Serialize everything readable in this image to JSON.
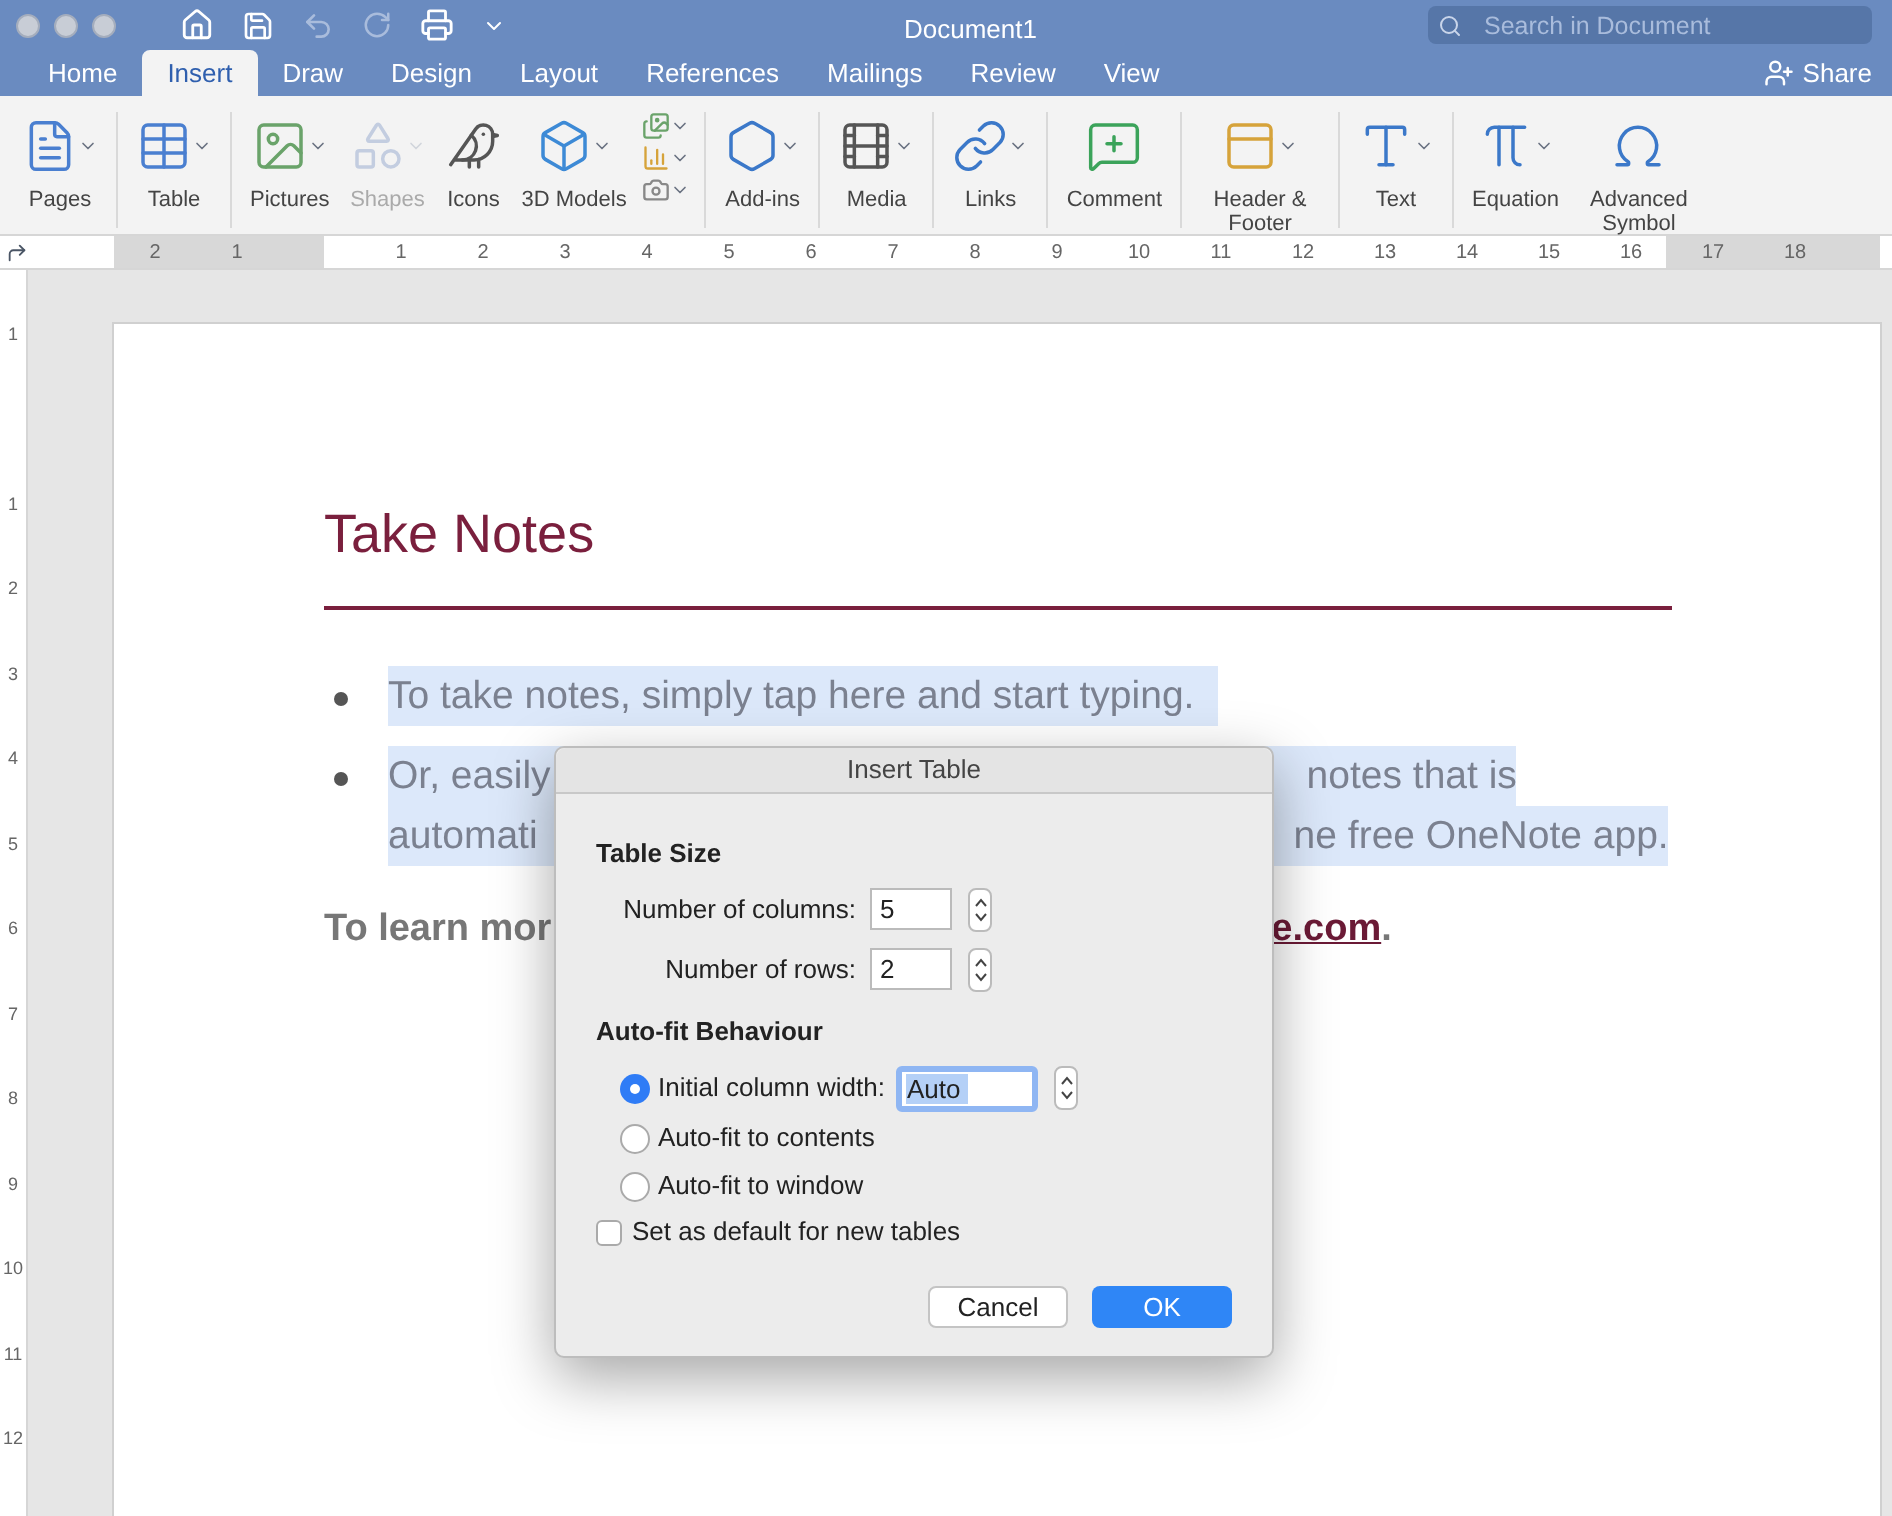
{
  "window": {
    "title": "Document1"
  },
  "search": {
    "placeholder": "Search in Document"
  },
  "tabs": [
    {
      "label": "Home",
      "selected": false
    },
    {
      "label": "Insert",
      "selected": true
    },
    {
      "label": "Draw",
      "selected": false
    },
    {
      "label": "Design",
      "selected": false
    },
    {
      "label": "Layout",
      "selected": false
    },
    {
      "label": "References",
      "selected": false
    },
    {
      "label": "Mailings",
      "selected": false
    },
    {
      "label": "Review",
      "selected": false
    },
    {
      "label": "View",
      "selected": false
    }
  ],
  "share": "Share",
  "ribbon": [
    {
      "label": "Pages",
      "dropdown": true,
      "disabled": false
    },
    {
      "label": "Table",
      "dropdown": true,
      "disabled": false
    },
    {
      "label": "Pictures",
      "dropdown": true,
      "disabled": false
    },
    {
      "label": "Shapes",
      "dropdown": true,
      "disabled": true
    },
    {
      "label": "Icons",
      "dropdown": false,
      "disabled": false
    },
    {
      "label": "3D Models",
      "dropdown": true,
      "disabled": false
    },
    {
      "label": "Add-ins",
      "dropdown": true,
      "disabled": false
    },
    {
      "label": "Media",
      "dropdown": true,
      "disabled": false
    },
    {
      "label": "Links",
      "dropdown": true,
      "disabled": false
    },
    {
      "label": "Comment",
      "dropdown": false,
      "disabled": false
    },
    {
      "label": "Header & Footer",
      "dropdown": true,
      "disabled": false
    },
    {
      "label": "Text",
      "dropdown": true,
      "disabled": false
    },
    {
      "label": "Equation",
      "dropdown": true,
      "disabled": false
    },
    {
      "label": "Advanced Symbol",
      "dropdown": false,
      "disabled": false
    }
  ],
  "ruler": {
    "left_numbers": [
      "2",
      "1"
    ],
    "numbers": [
      "1",
      "2",
      "3",
      "4",
      "5",
      "6",
      "7",
      "8",
      "9",
      "10",
      "11",
      "12",
      "13",
      "14",
      "15",
      "16",
      "17",
      "18"
    ]
  },
  "vertical_ruler": {
    "top_number": "1",
    "numbers": [
      "1",
      "2",
      "3",
      "4",
      "5",
      "6",
      "7",
      "8",
      "9",
      "10",
      "11",
      "12"
    ]
  },
  "document": {
    "heading": "Take Notes",
    "bullets": [
      {
        "lines": [
          {
            "left": "To take notes, simply tap here and start typing."
          }
        ]
      },
      {
        "lines": [
          {
            "left": "Or, easily",
            "right": "notes that is"
          },
          {
            "left": "automati",
            "right": "ne free OneNote app."
          }
        ]
      }
    ],
    "footer_left": "To learn mor",
    "footer_link": "e.com",
    "footer_end": "."
  },
  "dialog": {
    "title": "Insert Table",
    "section_1": "Table Size",
    "fields": [
      {
        "label": "Number of columns:",
        "value": "5"
      },
      {
        "label": "Number of rows:",
        "value": "2"
      }
    ],
    "section_2": "Auto-fit Behaviour",
    "options": [
      {
        "label": "Initial column width:",
        "selected": true,
        "value": "Auto"
      },
      {
        "label": "Auto-fit to contents",
        "selected": false
      },
      {
        "label": "Auto-fit to window",
        "selected": false
      }
    ],
    "default_checkbox": {
      "label": "Set as default for new tables",
      "checked": false
    },
    "buttons": [
      {
        "label": "Cancel",
        "primary": false
      },
      {
        "label": "OK",
        "primary": true
      }
    ]
  }
}
